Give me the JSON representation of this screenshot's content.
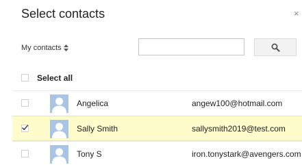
{
  "dialog": {
    "title": "Select contacts",
    "close_label": "×"
  },
  "toolbar": {
    "group_label": "My contacts",
    "group_arrows": "≑",
    "search_value": "",
    "search_placeholder": ""
  },
  "select_all": {
    "label": "Select all",
    "checked": false
  },
  "contacts": [
    {
      "name": "Angelica",
      "email": "angew100@hotmail.com",
      "checked": false
    },
    {
      "name": "Sally Smith",
      "email": "sallysmith2019@test.com",
      "checked": true
    },
    {
      "name": "Tony S",
      "email": "iron.tonystark@avengers.com",
      "checked": false
    }
  ],
  "colors": {
    "selected_row": "#fffccc",
    "avatar_bg": "#a9c4e4",
    "avatar_fg": "#ffffff"
  },
  "icons": {
    "search": "search-icon",
    "close": "close-icon",
    "check": "checkmark-icon",
    "avatar": "person-silhouette-icon"
  }
}
